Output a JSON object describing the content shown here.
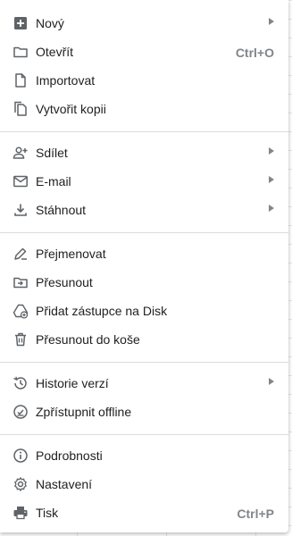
{
  "menu": {
    "items": [
      {
        "label": "Nový",
        "icon": "add-icon",
        "submenu": true
      },
      {
        "label": "Otevřít",
        "icon": "folder-icon",
        "shortcut": "Ctrl+O"
      },
      {
        "label": "Importovat",
        "icon": "file-icon"
      },
      {
        "label": "Vytvořit kopii",
        "icon": "copy-icon"
      },
      {
        "label": "Sdílet",
        "icon": "person-add-icon",
        "submenu": true
      },
      {
        "label": "E-mail",
        "icon": "mail-icon",
        "submenu": true
      },
      {
        "label": "Stáhnout",
        "icon": "download-icon",
        "submenu": true
      },
      {
        "label": "Přejmenovat",
        "icon": "rename-icon"
      },
      {
        "label": "Přesunout",
        "icon": "move-folder-icon"
      },
      {
        "label": "Přidat zástupce na Disk",
        "icon": "drive-shortcut-icon"
      },
      {
        "label": "Přesunout do koše",
        "icon": "trash-icon"
      },
      {
        "label": "Historie verzí",
        "icon": "history-icon",
        "submenu": true
      },
      {
        "label": "Zpřístupnit offline",
        "icon": "offline-icon"
      },
      {
        "label": "Podrobnosti",
        "icon": "info-icon"
      },
      {
        "label": "Nastavení",
        "icon": "gear-icon"
      },
      {
        "label": "Tisk",
        "icon": "print-icon",
        "shortcut": "Ctrl+P"
      }
    ]
  },
  "colors": {
    "text": "#202124",
    "icon": "#5f6368",
    "shortcut": "#80868b",
    "divider": "#dadce0"
  }
}
